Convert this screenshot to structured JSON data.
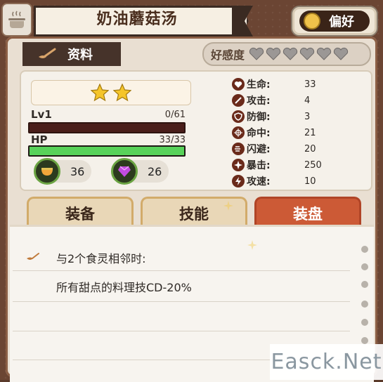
{
  "title": "奶油蘑菇汤",
  "preference_label": "偏好",
  "info_tab_label": "资料",
  "affinity": {
    "label": "好感度",
    "hearts_filled": 0,
    "hearts_total": 6
  },
  "stars": 2,
  "level": {
    "label": "Lv1",
    "value": "0/61",
    "progress": 0
  },
  "hp": {
    "label": "HP",
    "value": "33/33",
    "fraction": 1.0
  },
  "resources": [
    {
      "icon": "bowl-icon",
      "value": "36"
    },
    {
      "icon": "purple-gem-icon",
      "value": "26"
    }
  ],
  "stats": [
    {
      "label": "生命:",
      "value": "33",
      "icon": "heart-icon"
    },
    {
      "label": "攻击:",
      "value": "4",
      "icon": "attack-icon"
    },
    {
      "label": "防御:",
      "value": "3",
      "icon": "shield-icon"
    },
    {
      "label": "命中:",
      "value": "21",
      "icon": "crosshair-icon"
    },
    {
      "label": "闪避:",
      "value": "20",
      "icon": "dodge-icon"
    },
    {
      "label": "暴击:",
      "value": "250",
      "icon": "crit-icon"
    },
    {
      "label": "攻速:",
      "value": "10",
      "icon": "speed-icon"
    }
  ],
  "tabs": [
    {
      "label": "装备",
      "active": false
    },
    {
      "label": "技能",
      "active": false
    },
    {
      "label": "装盘",
      "active": true
    }
  ],
  "detail": {
    "line1": "与2个食灵相邻时:",
    "line2": "所有甜点的料理技CD-20%"
  },
  "watermark": "Easck.Net",
  "colors": {
    "accent_active_tab": "#cc5a36",
    "hp_bar": "#58d25a",
    "xp_bar": "#4a1e1a",
    "frame": "#6b4533"
  }
}
